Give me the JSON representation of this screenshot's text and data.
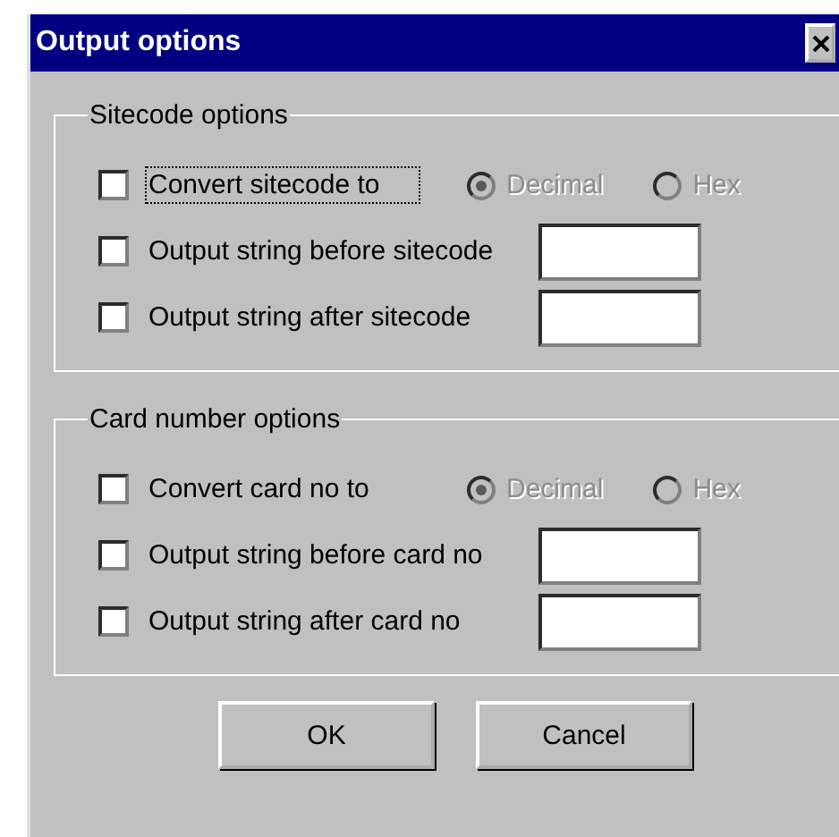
{
  "window": {
    "title": "Output options"
  },
  "groups": [
    {
      "legend": "Sitecode options",
      "rows": [
        {
          "kind": "radio",
          "label": "Convert sitecode to",
          "checked": false,
          "focused": true,
          "options": [
            {
              "label": "Decimal",
              "selected": true,
              "disabled": true
            },
            {
              "label": "Hex",
              "selected": false,
              "disabled": true
            }
          ]
        },
        {
          "kind": "text",
          "label": "Output string before sitecode",
          "checked": false,
          "focused": false
        },
        {
          "kind": "text",
          "label": "Output string after sitecode",
          "checked": false,
          "focused": false
        }
      ]
    },
    {
      "legend": "Card number options",
      "rows": [
        {
          "kind": "radio",
          "label": "Convert card no to",
          "checked": false,
          "focused": false,
          "options": [
            {
              "label": "Decimal",
              "selected": true,
              "disabled": true
            },
            {
              "label": "Hex",
              "selected": false,
              "disabled": true
            }
          ]
        },
        {
          "kind": "text",
          "label": "Output string before card no",
          "checked": false,
          "focused": false
        },
        {
          "kind": "text",
          "label": "Output string after card no",
          "checked": false,
          "focused": false
        }
      ]
    }
  ],
  "buttons": [
    "OK",
    "Cancel"
  ]
}
